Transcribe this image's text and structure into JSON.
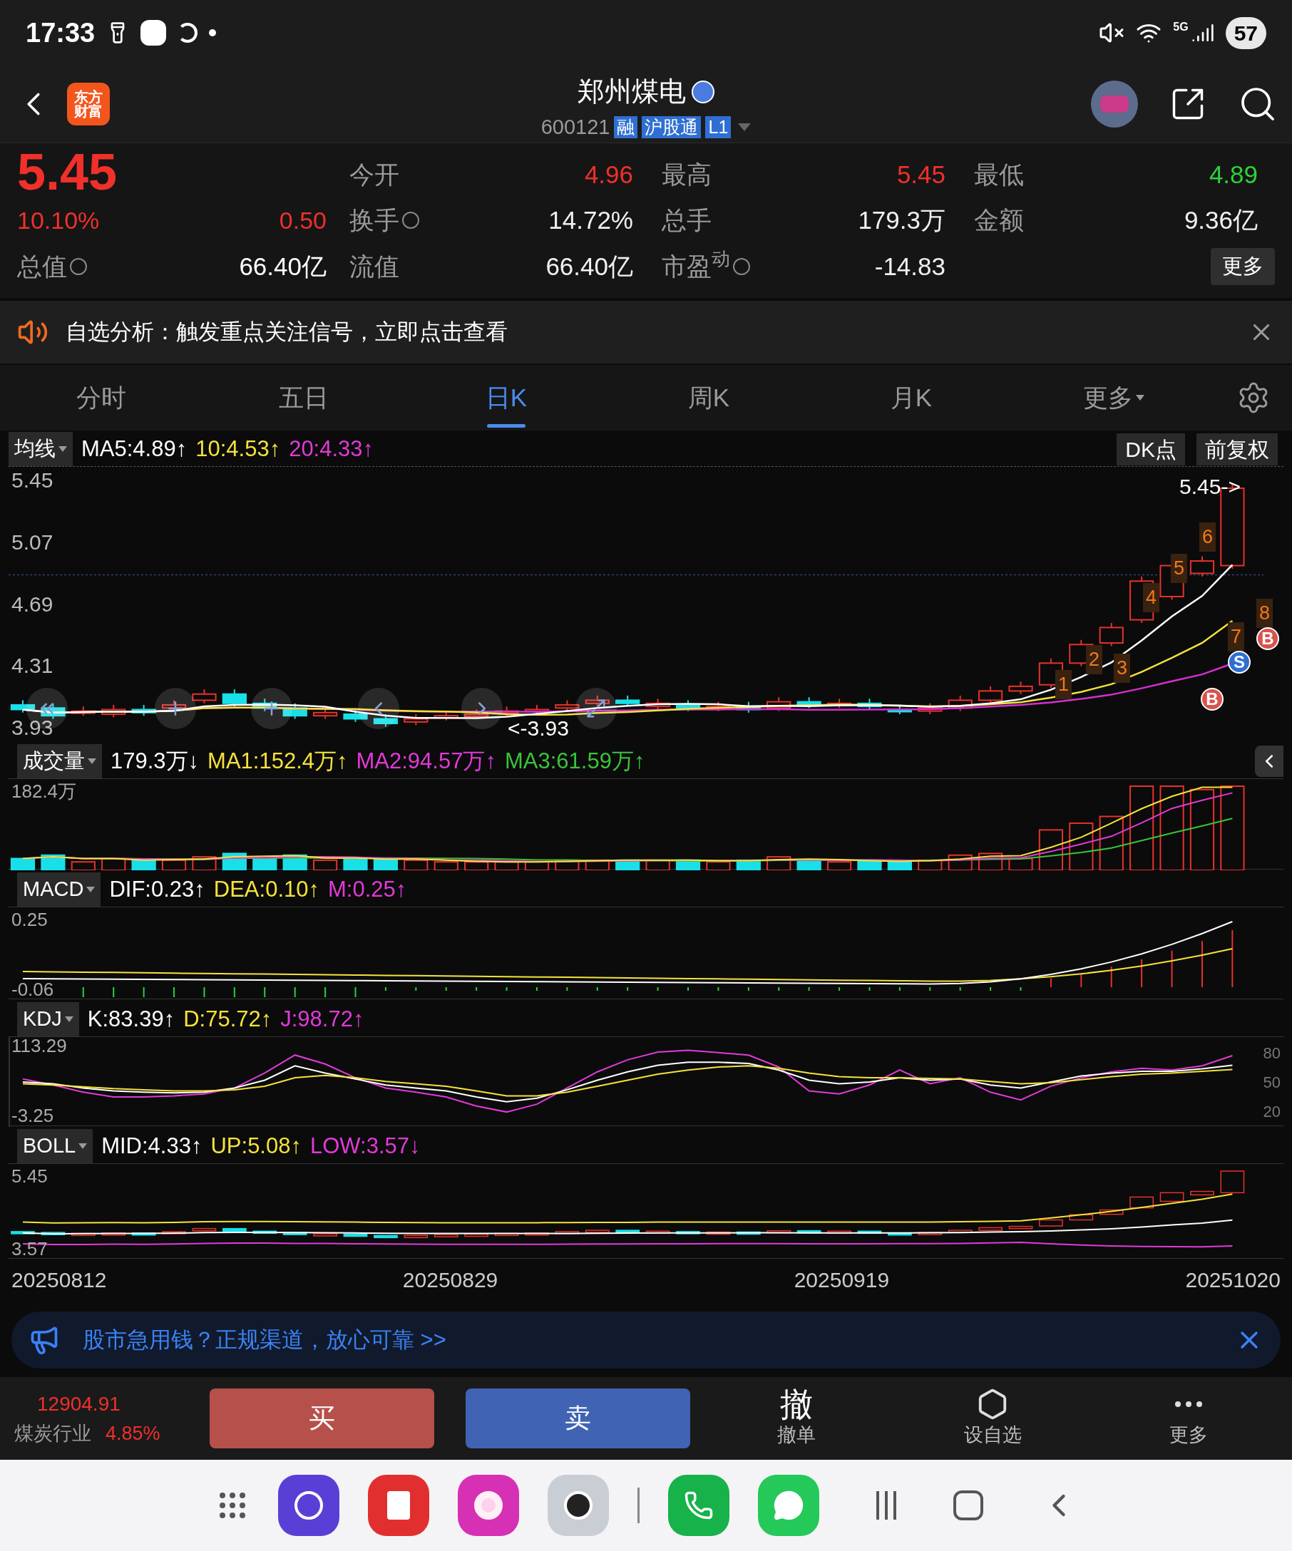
{
  "status_bar": {
    "time": "17:33",
    "network": "5G",
    "battery": "57"
  },
  "header": {
    "logo_lines": [
      "东方",
      "财富"
    ],
    "title": "郑州煤电",
    "code": "600121",
    "tags": [
      "融",
      "沪股通",
      "L1"
    ]
  },
  "quote": {
    "price": "5.45",
    "change_pct": "10.10%",
    "change": "0.50",
    "total_label": "总值",
    "total_value": "66.40亿",
    "fields": [
      {
        "label": "今开",
        "value": "4.96",
        "color": "#f0302a",
        "info": false
      },
      {
        "label": "最高",
        "value": "5.45",
        "color": "#f0302a",
        "info": false
      },
      {
        "label": "最低",
        "value": "4.89",
        "color": "#2bd13a",
        "info": false
      },
      {
        "label": "换手",
        "value": "14.72%",
        "color": "#f0f0f0",
        "info": true
      },
      {
        "label": "总手",
        "value": "179.3万",
        "color": "#f0f0f0",
        "info": false
      },
      {
        "label": "金额",
        "value": "9.36亿",
        "color": "#f0f0f0",
        "info": false
      },
      {
        "label": "流值",
        "value": "66.40亿",
        "color": "#f0f0f0",
        "info": false
      },
      {
        "label": "市盈$^{动}$",
        "value": "-14.83",
        "color": "#f0f0f0",
        "info": true
      }
    ],
    "more_button": "更多"
  },
  "notice": {
    "text": "自选分析：触发重点关注信号，立即点击查看"
  },
  "tabs": [
    {
      "label": "分时",
      "selected": false,
      "kind": "plain"
    },
    {
      "label": "五日",
      "selected": false,
      "kind": "plain"
    },
    {
      "label": "日K",
      "selected": true,
      "kind": "plain"
    },
    {
      "label": "周K",
      "selected": false,
      "kind": "plain"
    },
    {
      "label": "月K",
      "selected": false,
      "kind": "plain"
    },
    {
      "label": "更多",
      "selected": false,
      "kind": "dropdown"
    }
  ],
  "ma_bar": {
    "selector": "均线",
    "values": [
      {
        "text": "MA5:4.89↑",
        "color": "#ffffff"
      },
      {
        "text": "10:4.53↑",
        "color": "#f5e33a"
      },
      {
        "text": "20:4.33↑",
        "color": "#e23ad9"
      }
    ],
    "buttons": [
      "DK点",
      "前复权"
    ]
  },
  "price_chart": {
    "yticks": [
      "5.45",
      "5.07",
      "4.69",
      "4.31",
      "3.93"
    ],
    "high_label": "5.45->",
    "low_label": "<-3.93",
    "markers": [
      {
        "text": "1",
        "kind": "number"
      },
      {
        "text": "2",
        "kind": "number"
      },
      {
        "text": "3",
        "kind": "number"
      },
      {
        "text": "4",
        "kind": "number"
      },
      {
        "text": "5",
        "kind": "number"
      },
      {
        "text": "6",
        "kind": "number"
      },
      {
        "text": "7",
        "kind": "number"
      },
      {
        "text": "8",
        "kind": "number"
      },
      {
        "text": "B",
        "kind": "buy"
      },
      {
        "text": "S",
        "kind": "sell"
      },
      {
        "text": "B",
        "kind": "buy"
      }
    ]
  },
  "indicators": [
    {
      "kind": "volume",
      "selector": "成交量",
      "values": [
        {
          "text": "179.3万↓",
          "color": "#ffffff"
        },
        {
          "text": "MA1:152.4万↑",
          "color": "#f5e33a"
        },
        {
          "text": "MA2:94.57万↑",
          "color": "#e23ad9"
        },
        {
          "text": "MA3:61.59万↑",
          "color": "#3ac43a"
        }
      ],
      "yticks": [
        "182.4万"
      ]
    },
    {
      "kind": "macd",
      "selector": "MACD",
      "values": [
        {
          "text": "DIF:0.23↑",
          "color": "#ffffff"
        },
        {
          "text": "DEA:0.10↑",
          "color": "#f5e33a"
        },
        {
          "text": "M:0.25↑",
          "color": "#e23ad9"
        }
      ],
      "yticks": [
        "0.25",
        "-0.06"
      ]
    },
    {
      "kind": "kdj",
      "selector": "KDJ",
      "values": [
        {
          "text": "K:83.39↑",
          "color": "#ffffff"
        },
        {
          "text": "D:75.72↑",
          "color": "#f5e33a"
        },
        {
          "text": "J:98.72↑",
          "color": "#e23ad9"
        }
      ],
      "right_ticks": [
        "80",
        "50",
        "20"
      ],
      "chart_data": {
        "type": "line",
        "ylim": [
          -19.9,
          129.94
        ],
        "yticks": [
          113.29,
          -3.25
        ],
        "series": [
          {
            "color": "#e23ad9",
            "values": [
              60,
              50,
              38,
              30,
              30,
              32,
              35,
              45,
              70,
              100,
              85,
              62,
              45,
              38,
              30,
              15,
              5,
              18,
              45,
              72,
              92,
              105,
              108,
              104,
              100,
              80,
              40,
              35,
              50,
              75,
              52,
              62,
              38,
              25,
              48,
              62,
              72,
              78,
              75,
              82,
              99
            ]
          },
          {
            "color": "#ffffff",
            "values": [
              55,
              52,
              45,
              40,
              38,
              37,
              38,
              45,
              58,
              82,
              70,
              60,
              50,
              45,
              40,
              30,
              22,
              28,
              42,
              58,
              72,
              83,
              88,
              88,
              86,
              75,
              58,
              52,
              55,
              62,
              58,
              60,
              50,
              45,
              55,
              65,
              70,
              73,
              73,
              77,
              83
            ]
          },
          {
            "color": "#f5e33a",
            "values": [
              52,
              50,
              47,
              44,
              42,
              40,
              40,
              42,
              48,
              62,
              66,
              62,
              56,
              52,
              48,
              40,
              32,
              32,
              38,
              48,
              58,
              68,
              75,
              80,
              82,
              78,
              70,
              64,
              62,
              62,
              61,
              60,
              56,
              52,
              54,
              59,
              64,
              68,
              70,
              73,
              76
            ]
          }
        ]
      }
    },
    {
      "kind": "boll",
      "selector": "BOLL",
      "values": [
        {
          "text": "MID:4.33↑",
          "color": "#ffffff"
        },
        {
          "text": "UP:5.08↑",
          "color": "#f5e33a"
        },
        {
          "text": "LOW:3.57↓",
          "color": "#e23ad9"
        }
      ],
      "yticks": [
        "5.45",
        "3.57"
      ]
    }
  ],
  "dates": [
    "20250812",
    "20250829",
    "20250919",
    "20251020"
  ],
  "ad": {
    "text": "股市急用钱？正规渠道，放心可靠 >>"
  },
  "bottom_bar": {
    "index_value": "12904.91",
    "industry": "煤炭行业",
    "industry_pct": "4.85%",
    "buy": "买",
    "sell": "卖",
    "actions": [
      {
        "kind": "glyph",
        "glyph": "撤",
        "label": "撤单"
      },
      {
        "kind": "star",
        "label": "设自选"
      },
      {
        "kind": "dots",
        "label": "更多"
      }
    ]
  },
  "dock": {
    "apps": [
      {
        "kind": "grid"
      },
      {
        "kind": "browser"
      },
      {
        "kind": "notes"
      },
      {
        "kind": "gallery"
      },
      {
        "kind": "camera"
      },
      {
        "kind": "divider"
      },
      {
        "kind": "phone"
      },
      {
        "kind": "chat"
      }
    ]
  }
}
